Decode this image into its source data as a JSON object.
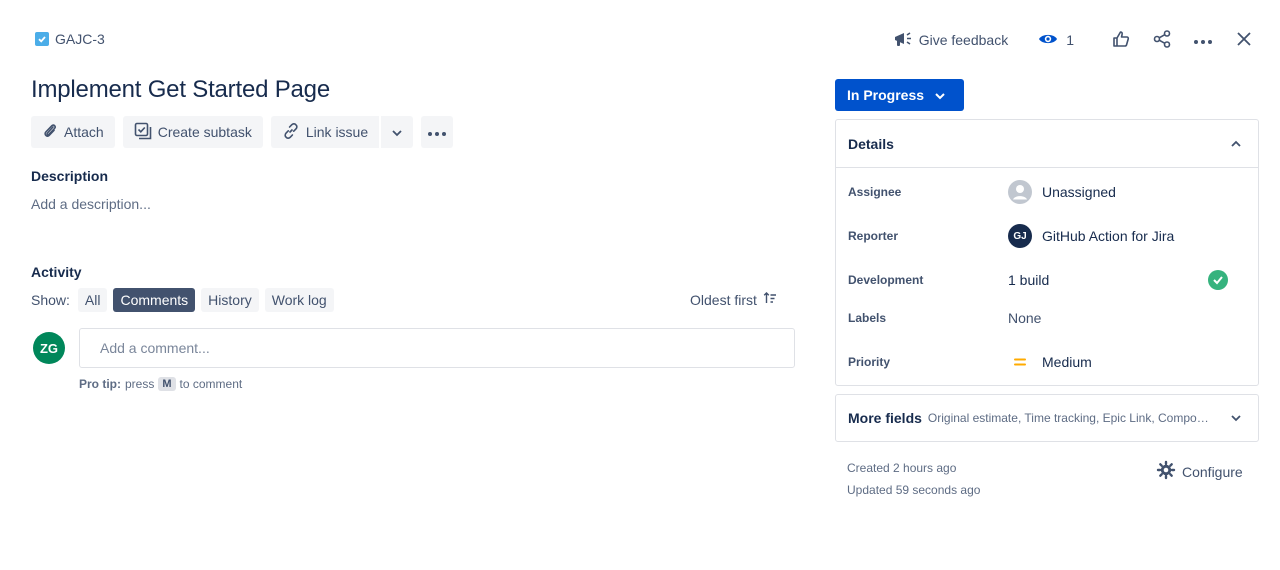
{
  "header": {
    "issue_key": "GAJC-3",
    "feedback_label": "Give feedback",
    "watch_count": "1"
  },
  "issue": {
    "title": "Implement Get Started Page"
  },
  "toolbar": {
    "attach_label": "Attach",
    "subtask_label": "Create subtask",
    "link_label": "Link issue"
  },
  "description": {
    "heading": "Description",
    "placeholder": "Add a description..."
  },
  "activity": {
    "heading": "Activity",
    "show_label": "Show:",
    "filters": [
      "All",
      "Comments",
      "History",
      "Work log"
    ],
    "active_filter": "Comments",
    "sort_label": "Oldest first",
    "user_initials": "ZG",
    "comment_placeholder": "Add a comment...",
    "protip_lead": "Pro tip:",
    "protip_press": "press",
    "protip_key": "M",
    "protip_tail": "to comment"
  },
  "status": {
    "label": "In Progress"
  },
  "details": {
    "heading": "Details",
    "assignee_label": "Assignee",
    "assignee_value": "Unassigned",
    "reporter_label": "Reporter",
    "reporter_initials": "GJ",
    "reporter_value": "GitHub Action for Jira",
    "development_label": "Development",
    "development_value": "1 build",
    "labels_label": "Labels",
    "labels_value": "None",
    "priority_label": "Priority",
    "priority_value": "Medium"
  },
  "more_fields": {
    "title": "More fields",
    "subtitle": "Original estimate, Time tracking, Epic Link, Components"
  },
  "footer": {
    "created": "Created 2 hours ago",
    "updated": "Updated 59 seconds ago",
    "configure_label": "Configure"
  },
  "colors": {
    "brand_blue": "#0052cc",
    "success_green": "#36b37e",
    "priority_orange": "#ffab00",
    "user_avatar": "#00875a"
  }
}
